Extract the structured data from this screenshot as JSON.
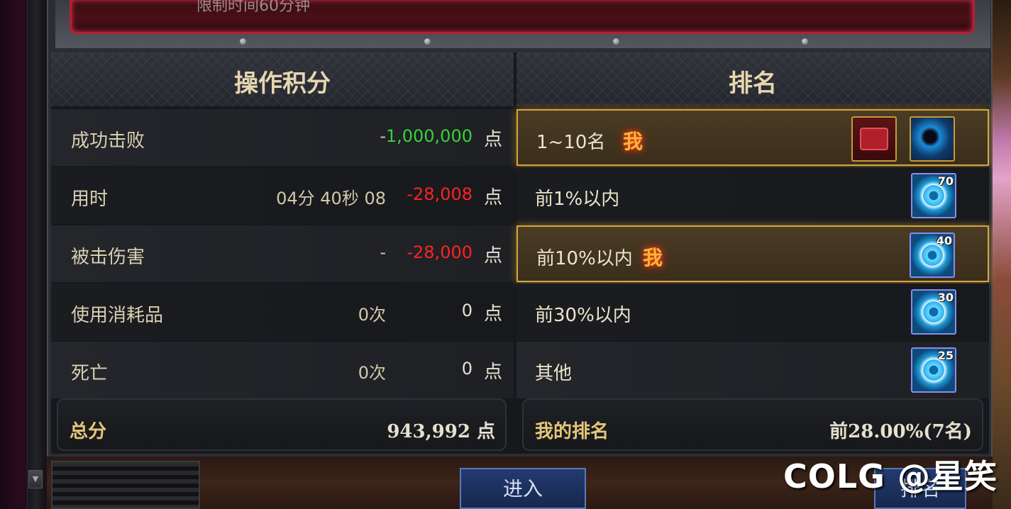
{
  "banner": {
    "text": "限制时间60分钟"
  },
  "headers": {
    "score": "操作积分",
    "rank": "排名"
  },
  "score_rows": [
    {
      "label": "成功击败",
      "detail": "-",
      "value": "1,000,000",
      "unit": "点"
    },
    {
      "label": "用时",
      "detail": "04分 40秒 08",
      "value": "-28,008",
      "unit": "点"
    },
    {
      "label": "被击伤害",
      "detail": "-",
      "value": "-28,000",
      "unit": "点"
    },
    {
      "label": "使用消耗品",
      "detail": "0次",
      "value": "0",
      "unit": "点"
    },
    {
      "label": "死亡",
      "detail": "0次",
      "value": "0",
      "unit": "点"
    }
  ],
  "rank_rows": [
    {
      "label": "1~10名",
      "me": "我",
      "reward_count": ""
    },
    {
      "label": "前1%以内",
      "me": "",
      "reward_count": "70"
    },
    {
      "label": "前10%以内",
      "me": "我",
      "reward_count": "40"
    },
    {
      "label": "前30%以内",
      "me": "",
      "reward_count": "30"
    },
    {
      "label": "其他",
      "me": "",
      "reward_count": "25"
    }
  ],
  "total": {
    "label": "总分",
    "value": "943,992 点"
  },
  "my_rank": {
    "label": "我的排名",
    "value": "前28.00%(7名)"
  },
  "buttons": {
    "enter": "进入",
    "rank": "排名"
  },
  "watermark": "COLG @星笑",
  "icons": [
    "crest-reward-icon",
    "orb-reward-icon",
    "gear-reward-icon"
  ],
  "colors": {
    "positive": "#39d13a",
    "negative": "#ff2222",
    "highlight": "#d6a63e",
    "me": "#ffb43a"
  }
}
